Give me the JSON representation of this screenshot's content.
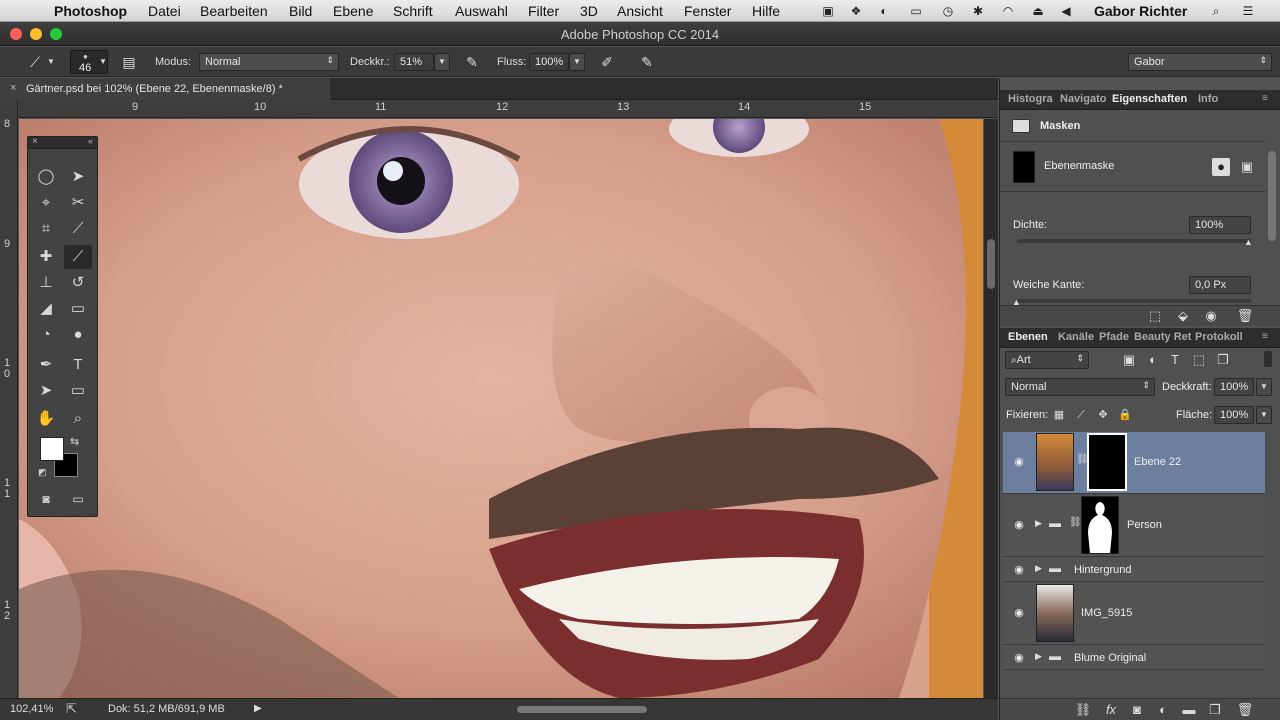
{
  "menubar": {
    "apple_icon": "apple-icon",
    "items": [
      "Photoshop",
      "Datei",
      "Bearbeiten",
      "Bild",
      "Ebene",
      "Schrift",
      "Auswahl",
      "Filter",
      "3D",
      "Ansicht",
      "Fenster",
      "Hilfe"
    ],
    "user": "Gabor Richter"
  },
  "window": {
    "title": "Adobe Photoshop CC 2014"
  },
  "options": {
    "brush_size": "46",
    "mode_label": "Modus:",
    "mode_value": "Normal",
    "opacity_label": "Deckkr.:",
    "opacity_value": "51%",
    "flow_label": "Fluss:",
    "flow_value": "100%",
    "workspace": "Gabor"
  },
  "document": {
    "tab_title": "Gärtner.psd bei 102% (Ebene 22, Ebenenmaske/8) *"
  },
  "ruler": {
    "h": [
      "9",
      "10",
      "11",
      "12",
      "13",
      "14",
      "15"
    ],
    "v": [
      "8",
      "9",
      "1 0",
      "1 1",
      "1 2"
    ]
  },
  "status": {
    "zoom": "102,41%",
    "doc": "Dok: 51,2 MB/691,9 MB"
  },
  "props": {
    "tabs": [
      "Histogra",
      "Navigato",
      "Eigenschaften",
      "Info"
    ],
    "section": "Masken",
    "mask_type": "Ebenenmaske",
    "density_label": "Dichte:",
    "density_value": "100%",
    "feather_label": "Weiche Kante:",
    "feather_value": "0,0 Px"
  },
  "layers_panel": {
    "tabs": [
      "Ebenen",
      "Kanäle",
      "Pfade",
      "Beauty Ret",
      "Protokoll"
    ],
    "filter_kind": "Art",
    "blend_mode": "Normal",
    "opacity_label": "Deckkraft:",
    "opacity_value": "100%",
    "lock_label": "Fixieren:",
    "fill_label": "Fläche:",
    "fill_value": "100%",
    "layers": [
      {
        "name": "Ebene 22",
        "selected": true
      },
      {
        "name": "Person"
      },
      {
        "name": "Hintergrund"
      },
      {
        "name": "IMG_5915"
      },
      {
        "name": "Blume Original"
      }
    ]
  },
  "colors": {
    "foreground": "#ffffff",
    "background": "#000000",
    "selection": "#6c7f9f"
  }
}
